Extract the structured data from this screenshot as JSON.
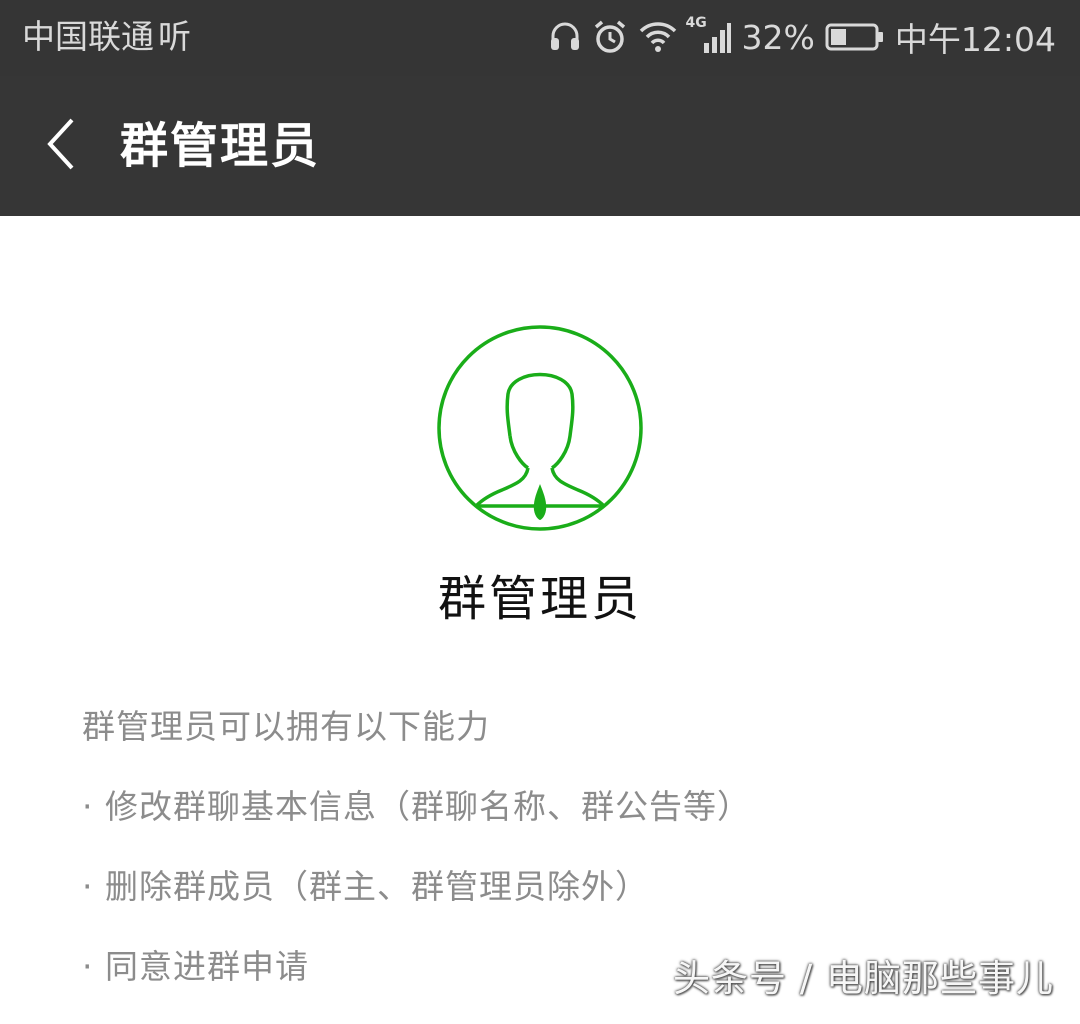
{
  "status_bar": {
    "carrier": "中国联通",
    "carrier_badge": "听",
    "network": "4G",
    "battery": "32%",
    "time": "中午12:04",
    "icons": [
      "headset-icon",
      "alarm-icon",
      "wifi-icon",
      "signal-icon",
      "battery-icon"
    ]
  },
  "header": {
    "back_icon": "chevron-left-icon",
    "title": "群管理员"
  },
  "main": {
    "avatar_icon": "admin-avatar-icon",
    "title": "群管理员",
    "intro": "群管理员可以拥有以下能力",
    "abilities": [
      "· 修改群聊基本信息（群聊名称、群公告等）",
      "· 删除群成员（群主、群管理员除外）",
      "· 同意进群申请"
    ]
  },
  "watermark": "头条号 / 电脑那些事儿",
  "colors": {
    "bar_background": "#363636",
    "accent_green": "#1aad19",
    "body_text": "#111111",
    "secondary_text": "#8c8c8c"
  }
}
